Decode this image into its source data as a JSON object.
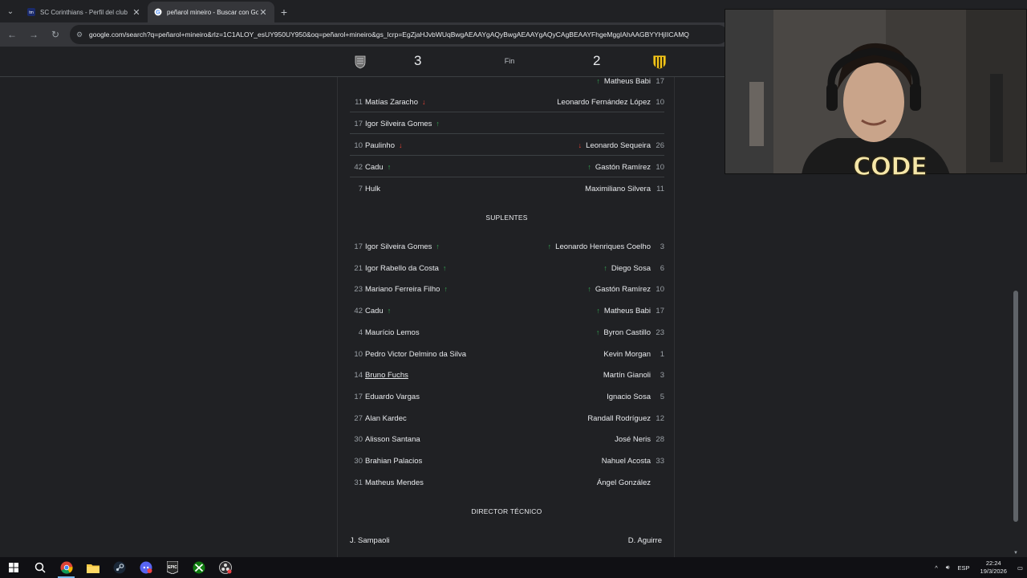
{
  "browser": {
    "tabs": [
      {
        "title": "SC Corinthians - Perfil del club",
        "active": false
      },
      {
        "title": "peñarol mineiro - Buscar con Google",
        "active": true
      }
    ],
    "url": "google.com/search?q=peñarol+mineiro&rlz=1C1ALOY_esUY950UY950&oq=peñarol+mineiro&gs_lcrp=EgZjaHJvbWUqBwgAEAAYgAQyBwgAEAAYgAQyCAgBEAAYFhgeMggIAhAAGBYYHjIICAMQ"
  },
  "score": {
    "home_score": "3",
    "status": "Fin",
    "away_score": "2"
  },
  "lineup": [
    {
      "lnum": "",
      "lname": "",
      "rname": "Matheus Babi",
      "rnum": "17",
      "r_arrow": "up"
    },
    {
      "lnum": "11",
      "lname": "Matías Zaracho",
      "l_arrow": "down",
      "rname": "Leonardo Fernández López",
      "rnum": "10"
    },
    {
      "lnum": "17",
      "lname": "Igor Silveira Gomes",
      "l_arrow": "up",
      "rname": "",
      "rnum": ""
    },
    {
      "lnum": "10",
      "lname": "Paulinho",
      "l_arrow": "down",
      "rname": "Leonardo Sequeira",
      "rnum": "26",
      "r_arrow": "down"
    },
    {
      "lnum": "42",
      "lname": "Cadu",
      "l_arrow": "up",
      "rname": "Gastón Ramírez",
      "rnum": "10",
      "r_arrow": "up"
    },
    {
      "lnum": "7",
      "lname": "Hulk",
      "rname": "Maximiliano Silvera",
      "rnum": "11"
    }
  ],
  "subs_header": "SUPLENTES",
  "subs": [
    {
      "lnum": "17",
      "lname": "Igor Silveira Gomes",
      "l_arrow": "up",
      "rname": "Leonardo Henriques Coelho",
      "rnum": "3",
      "r_arrow": "up"
    },
    {
      "lnum": "21",
      "lname": "Igor Rabello da Costa",
      "l_arrow": "up",
      "rname": "Diego Sosa",
      "rnum": "6",
      "r_arrow": "up"
    },
    {
      "lnum": "23",
      "lname": "Mariano Ferreira Filho",
      "l_arrow": "up",
      "rname": "Gastón Ramírez",
      "rnum": "10",
      "r_arrow": "up"
    },
    {
      "lnum": "42",
      "lname": "Cadu",
      "l_arrow": "up",
      "rname": "Matheus Babi",
      "rnum": "17",
      "r_arrow": "up"
    },
    {
      "lnum": "4",
      "lname": "Maurício Lemos",
      "rname": "Byron Castillo",
      "rnum": "23",
      "r_arrow": "up"
    },
    {
      "lnum": "10",
      "lname": "Pedro Victor Delmino da Silva",
      "rname": "Kevin Morgan",
      "rnum": "1"
    },
    {
      "lnum": "14",
      "lname": "Bruno Fuchs",
      "underline": true,
      "rname": "Martín Gianoli",
      "rnum": "3"
    },
    {
      "lnum": "17",
      "lname": "Eduardo Vargas",
      "rname": "Ignacio Sosa",
      "rnum": "5"
    },
    {
      "lnum": "27",
      "lname": "Alan Kardec",
      "rname": "Randall Rodríguez",
      "rnum": "12"
    },
    {
      "lnum": "30",
      "lname": "Alisson Santana",
      "rname": "José Neris",
      "rnum": "28"
    },
    {
      "lnum": "30",
      "lname": "Brahian Palacios",
      "rname": "Nahuel Acosta",
      "rnum": "33"
    },
    {
      "lnum": "31",
      "lname": "Matheus Mendes",
      "rname": "Ángel González",
      "rnum": ""
    }
  ],
  "coach_header": "DIRECTOR TÉCNICO",
  "coaches": {
    "home": "J. Sampaoli",
    "away": "D. Aguirre"
  },
  "overlay": {
    "cam_text": "CODE"
  },
  "taskbar": {
    "lang": "ESP",
    "time": "22:24",
    "date": "19/3/2026"
  },
  "colors": {
    "up_arrow": "#34a853",
    "down_arrow": "#ea4335",
    "background": "#202124"
  }
}
